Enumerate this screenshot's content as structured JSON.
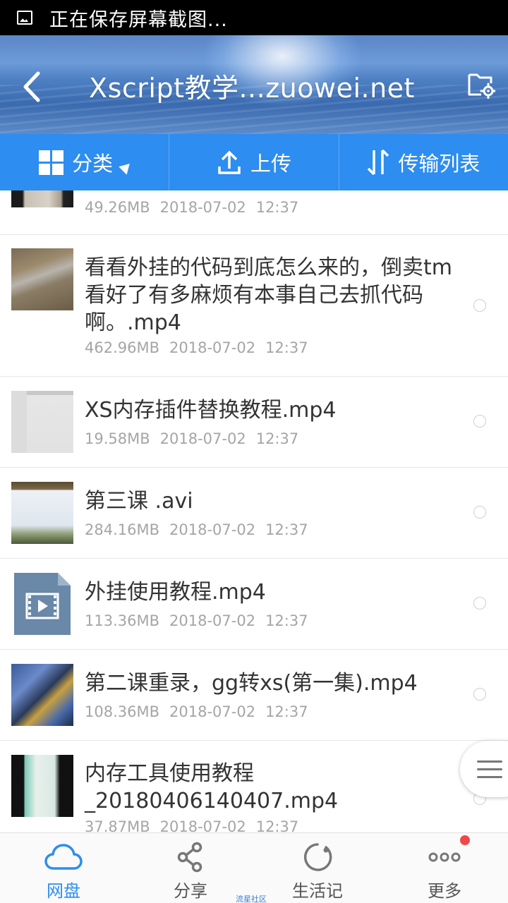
{
  "status_bar": {
    "text": "正在保存屏幕截图..."
  },
  "header": {
    "title": "Xscript教学...zuowei.net"
  },
  "toolbar": {
    "category_label": "分类",
    "upload_label": "上传",
    "transfer_label": "传输列表"
  },
  "files": [
    {
      "name": "",
      "size": "49.26MB",
      "date": "2018-07-02",
      "time": "12:37"
    },
    {
      "name": "看看外挂的代码到底怎么来的，倒卖tm看好了有多麻烦有本事自己去抓代码啊。.mp4",
      "size": "462.96MB",
      "date": "2018-07-02",
      "time": "12:37"
    },
    {
      "name": "XS内存插件替换教程.mp4",
      "size": "19.58MB",
      "date": "2018-07-02",
      "time": "12:37"
    },
    {
      "name": "第三课 .avi",
      "size": "284.16MB",
      "date": "2018-07-02",
      "time": "12:37"
    },
    {
      "name": "外挂使用教程.mp4",
      "size": "113.36MB",
      "date": "2018-07-02",
      "time": "12:37"
    },
    {
      "name": "第二课重录，gg转xs(第一集).mp4",
      "size": "108.36MB",
      "date": "2018-07-02",
      "time": "12:37"
    },
    {
      "name": "内存工具使用教程_20180406140407.mp4",
      "size": "37.87MB",
      "date": "2018-07-02",
      "time": "12:37"
    }
  ],
  "bottom_nav": {
    "items": [
      {
        "label": "网盘",
        "icon": "cloud-icon",
        "active": true
      },
      {
        "label": "分享",
        "icon": "share-icon",
        "active": false
      },
      {
        "label": "生活记",
        "icon": "life-record-icon",
        "active": false
      },
      {
        "label": "更多",
        "icon": "more-icon",
        "active": false
      }
    ]
  },
  "watermark": "流星社区",
  "colors": {
    "accent": "#2d8df0",
    "badge": "#f04848",
    "text": "#333333",
    "meta": "#a5a5a5"
  }
}
